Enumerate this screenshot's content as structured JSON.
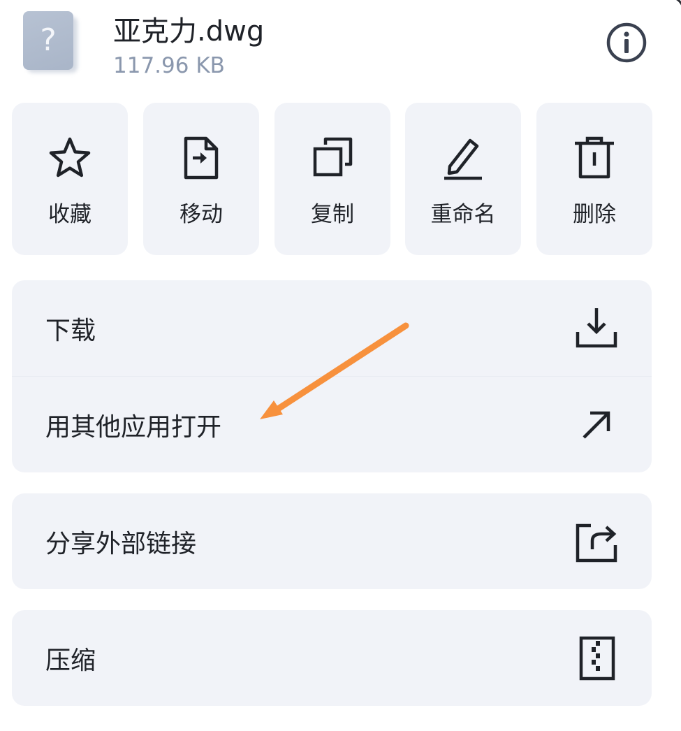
{
  "file": {
    "name": "亚克力.dwg",
    "size": "117.96 KB",
    "thumb_icon": "unknown-file-icon",
    "thumb_glyph": "?"
  },
  "header": {
    "info_icon": "info-icon"
  },
  "quick_actions": [
    {
      "label": "收藏",
      "icon": "star-icon"
    },
    {
      "label": "移动",
      "icon": "move-file-icon"
    },
    {
      "label": "复制",
      "icon": "copy-icon"
    },
    {
      "label": "重命名",
      "icon": "rename-pencil-icon"
    },
    {
      "label": "删除",
      "icon": "trash-icon"
    }
  ],
  "menu": {
    "download": {
      "label": "下载",
      "icon": "download-icon"
    },
    "open_with": {
      "label": "用其他应用打开",
      "icon": "arrow-up-right-icon"
    },
    "share_link": {
      "label": "分享外部链接",
      "icon": "share-icon"
    },
    "compress": {
      "label": "压缩",
      "icon": "zip-icon"
    }
  },
  "colors": {
    "tile_bg": "#f1f3f8",
    "text": "#1f2228",
    "secondary_text": "#8a97ad",
    "annotation_arrow": "#f7913d"
  }
}
